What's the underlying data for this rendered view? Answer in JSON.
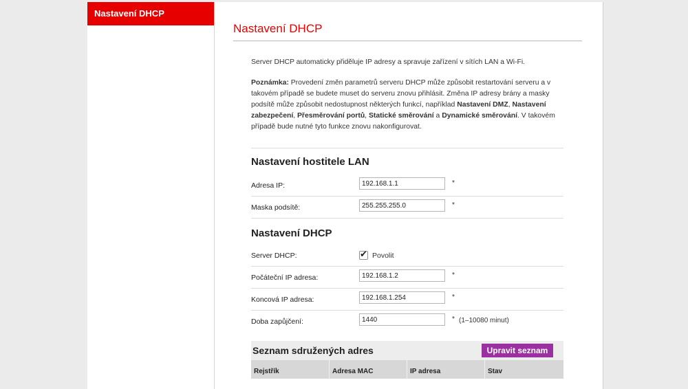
{
  "sidebar": {
    "items": [
      {
        "label": "Nastavení DHCP",
        "active": true
      }
    ],
    "active_color": "#e60000"
  },
  "main": {
    "title": "Nastavení DHCP",
    "title_color": "#e60000",
    "intro": "Server DHCP automaticky přiděluje IP adresy a spravuje zařízení v sítích LAN a Wi-Fi.",
    "note": {
      "label": "Poznámka:",
      "t1": " Provedení změn parametrů serveru DHCP může způsobit restartování serveru a v takovém případě se budete muset do serveru znovu přihlásit. Změna IP adresy brány a masky podsítě může způsobit nedostupnost některých funkcí, například ",
      "b1": "Nastavení DMZ",
      "s1": ", ",
      "b2": "Nastavení zabezpečení",
      "s2": ", ",
      "b3": "Přesměrování portů",
      "s3": ", ",
      "b4": "Statické směrování",
      "s4": " a ",
      "b5": "Dynamické směrování",
      "t2": ". V takovém případě bude nutné tyto funkce znovu nakonfigurovat."
    }
  },
  "lan": {
    "title": "Nastavení hostitele LAN",
    "ip_label": "Adresa IP:",
    "ip_value": "192.168.1.1",
    "mask_label": "Maska podsítě:",
    "mask_value": "255.255.255.0",
    "required_mark": "*"
  },
  "dhcp": {
    "title": "Nastavení DHCP",
    "server_label": "Server DHCP:",
    "server_checked": true,
    "server_option": "Povolit",
    "start_label": "Počáteční IP adresa:",
    "start_value": "192.168.1.2",
    "end_label": "Koncová IP adresa:",
    "end_value": "192.168.1.254",
    "lease_label": "Doba zapůjčení:",
    "lease_value": "1440",
    "lease_hint": "(1–10080 minut)",
    "required_mark": "*"
  },
  "pool": {
    "title": "Seznam sdružených adres",
    "edit_button": "Upravit seznam",
    "button_color": "#9b31a0",
    "columns": [
      "Rejstřík",
      "Adresa MAC",
      "IP adresa",
      "Stav"
    ]
  }
}
